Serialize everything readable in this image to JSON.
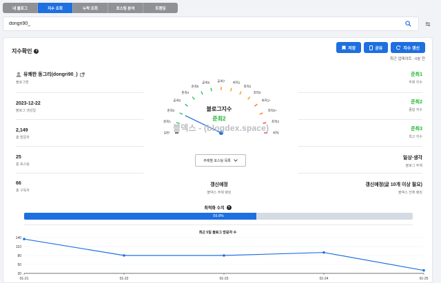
{
  "tabs": [
    {
      "label": "내 블로그",
      "active": false
    },
    {
      "label": "지수 조회",
      "active": true
    },
    {
      "label": "누락 조회",
      "active": false
    },
    {
      "label": "포스팅 분석",
      "active": false
    },
    {
      "label": "트렌딩",
      "active": false
    }
  ],
  "search": {
    "value": "dongri90_",
    "placeholder": ""
  },
  "card": {
    "title": "지수확인",
    "info": "?",
    "updated": "최근 업데이트 : 0분 전"
  },
  "actions": {
    "save": "저장",
    "share": "공유",
    "refresh": "지수 갱신"
  },
  "left": {
    "name": "유쾌한 동그리(dongri90_)",
    "name_label": "블로그명",
    "created": "2023-12-22",
    "created_label": "블로그 생성일",
    "visitors": "2,149",
    "visitors_label": "총 방문자",
    "posts": "25",
    "posts_label": "총 포스팅",
    "subscribers": "66",
    "subscribers_label": "총 구독자"
  },
  "right": {
    "topic_index": "준최1",
    "topic_index_label": "주제 지수",
    "overall_index": "준최2",
    "overall_index_label": "종합 지수",
    "max_index": "준최3",
    "max_index_label": "최고 지수",
    "blog_topic": "일상·생각",
    "blog_topic_label": "블로그 주제",
    "overall_rank": "갱신예정(글 10개 이상 필요)",
    "overall_rank_label": "블덱스 전체 랭킹"
  },
  "middle": {
    "topic_rank": "갱신예정",
    "topic_rank_label": "블덱스 주제 랭킹",
    "dropdown": "주제별 포스팅 목록"
  },
  "gauge": {
    "title": "블로그지수",
    "value": "준최2",
    "watermark": "블덱스 - (blogdex.space)",
    "labels": [
      "일반",
      "준최1",
      "준최2",
      "준최3",
      "준최4",
      "준최5",
      "준최6",
      "준최7",
      "최적1",
      "최적2",
      "최적3",
      "최적1+",
      "최적2+",
      "최적3+",
      "최적4+"
    ],
    "needle_index": 2
  },
  "optimization": {
    "title": "최적화 수치",
    "percent": 59.8,
    "percent_label": "59.8%"
  },
  "chart_data": {
    "type": "line",
    "title": "최근 5일 블로그 방문자 수",
    "x": [
      "01-21",
      "01-22",
      "01-23",
      "01-24",
      "01-25"
    ],
    "values": [
      135,
      80,
      80,
      90,
      30
    ],
    "ylim": [
      20,
      140
    ],
    "yticks": [
      20,
      50,
      80,
      110,
      140
    ],
    "color": "#1e6fe0"
  }
}
